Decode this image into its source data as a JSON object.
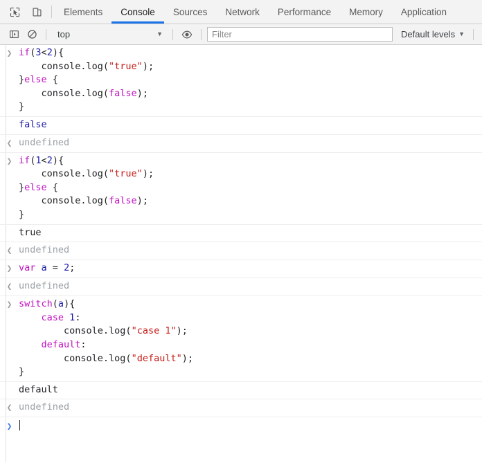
{
  "devtools": {
    "left_buttons": [
      {
        "name": "inspect-element-icon",
        "title": "Inspect element"
      },
      {
        "name": "device-toolbar-icon",
        "title": "Toggle device toolbar"
      }
    ],
    "tabs": [
      {
        "label": "Elements",
        "active": false
      },
      {
        "label": "Console",
        "active": true
      },
      {
        "label": "Sources",
        "active": false
      },
      {
        "label": "Network",
        "active": false
      },
      {
        "label": "Performance",
        "active": false
      },
      {
        "label": "Memory",
        "active": false
      },
      {
        "label": "Application",
        "active": false
      }
    ],
    "accent_color": "#1a73e8"
  },
  "console_toolbar": {
    "sidebar_button": "console-sidebar-icon",
    "clear_button": "clear-console-icon",
    "context": "top",
    "context_caret": "▼",
    "eye_button": "live-expression-eye-icon",
    "filter": {
      "placeholder": "Filter",
      "value": ""
    },
    "levels": {
      "label": "Default levels",
      "caret": "▼"
    }
  },
  "console_messages": [
    {
      "type": "input",
      "glyph": "❯",
      "lines": [
        [
          {
            "t": "if",
            "c": "kw"
          },
          {
            "t": "(",
            "c": "pl"
          },
          {
            "t": "3",
            "c": "num"
          },
          {
            "t": "<",
            "c": "pl"
          },
          {
            "t": "2",
            "c": "num"
          },
          {
            "t": "){",
            "c": "pl"
          }
        ],
        [
          {
            "t": "    console.log(",
            "c": "pl"
          },
          {
            "t": "\"true\"",
            "c": "str"
          },
          {
            "t": ");",
            "c": "pl"
          }
        ],
        [
          {
            "t": "}",
            "c": "pl"
          },
          {
            "t": "else",
            "c": "kw"
          },
          {
            "t": " {",
            "c": "pl"
          }
        ],
        [
          {
            "t": "    console.log(",
            "c": "pl"
          },
          {
            "t": "false",
            "c": "kw"
          },
          {
            "t": ");",
            "c": "pl"
          }
        ],
        [
          {
            "t": "}",
            "c": "pl"
          }
        ]
      ]
    },
    {
      "type": "log",
      "glyph": "",
      "text": "false",
      "color": "val-blue"
    },
    {
      "type": "result",
      "glyph": "❮",
      "text": "undefined",
      "color": "val-grey"
    },
    {
      "type": "input",
      "glyph": "❯",
      "lines": [
        [
          {
            "t": "if",
            "c": "kw"
          },
          {
            "t": "(",
            "c": "pl"
          },
          {
            "t": "1",
            "c": "num"
          },
          {
            "t": "<",
            "c": "pl"
          },
          {
            "t": "2",
            "c": "num"
          },
          {
            "t": "){",
            "c": "pl"
          }
        ],
        [
          {
            "t": "    console.log(",
            "c": "pl"
          },
          {
            "t": "\"true\"",
            "c": "str"
          },
          {
            "t": ");",
            "c": "pl"
          }
        ],
        [
          {
            "t": "}",
            "c": "pl"
          },
          {
            "t": "else",
            "c": "kw"
          },
          {
            "t": " {",
            "c": "pl"
          }
        ],
        [
          {
            "t": "    console.log(",
            "c": "pl"
          },
          {
            "t": "false",
            "c": "kw"
          },
          {
            "t": ");",
            "c": "pl"
          }
        ],
        [
          {
            "t": "}",
            "c": "pl"
          }
        ]
      ]
    },
    {
      "type": "log",
      "glyph": "",
      "text": "true",
      "color": "val-dark"
    },
    {
      "type": "result",
      "glyph": "❮",
      "text": "undefined",
      "color": "val-grey"
    },
    {
      "type": "input",
      "glyph": "❯",
      "lines": [
        [
          {
            "t": "var",
            "c": "kw"
          },
          {
            "t": " ",
            "c": "pl"
          },
          {
            "t": "a",
            "c": "id"
          },
          {
            "t": " = ",
            "c": "pl"
          },
          {
            "t": "2",
            "c": "num"
          },
          {
            "t": ";",
            "c": "pl"
          }
        ]
      ]
    },
    {
      "type": "result",
      "glyph": "❮",
      "text": "undefined",
      "color": "val-grey"
    },
    {
      "type": "input",
      "glyph": "❯",
      "lines": [
        [
          {
            "t": "switch",
            "c": "kw"
          },
          {
            "t": "(",
            "c": "pl"
          },
          {
            "t": "a",
            "c": "id"
          },
          {
            "t": "){",
            "c": "pl"
          }
        ],
        [
          {
            "t": "    ",
            "c": "pl"
          },
          {
            "t": "case",
            "c": "kw"
          },
          {
            "t": " ",
            "c": "pl"
          },
          {
            "t": "1",
            "c": "num"
          },
          {
            "t": ":",
            "c": "pl"
          }
        ],
        [
          {
            "t": "        console.log(",
            "c": "pl"
          },
          {
            "t": "\"case 1\"",
            "c": "str"
          },
          {
            "t": ");",
            "c": "pl"
          }
        ],
        [
          {
            "t": "    ",
            "c": "pl"
          },
          {
            "t": "default",
            "c": "kw"
          },
          {
            "t": ":",
            "c": "pl"
          }
        ],
        [
          {
            "t": "        console.log(",
            "c": "pl"
          },
          {
            "t": "\"default\"",
            "c": "str"
          },
          {
            "t": ");",
            "c": "pl"
          }
        ],
        [
          {
            "t": "}",
            "c": "pl"
          }
        ]
      ]
    },
    {
      "type": "log",
      "glyph": "",
      "text": "default",
      "color": "val-dark"
    },
    {
      "type": "result",
      "glyph": "❮",
      "text": "undefined",
      "color": "val-grey"
    }
  ],
  "console_prompt": {
    "glyph": "❯",
    "value": ""
  }
}
